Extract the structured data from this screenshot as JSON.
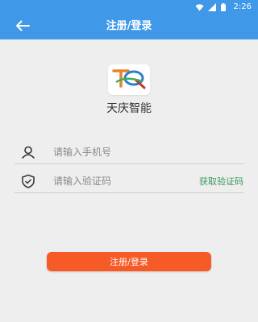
{
  "status_bar": {
    "time": "2:26",
    "icons": [
      "wifi-icon",
      "signal-icon",
      "battery-icon"
    ]
  },
  "toolbar": {
    "title": "注册/登录",
    "back_icon": "back-arrow-icon",
    "color": "#3f98e8"
  },
  "app": {
    "logo_icon": "tq-logo-icon",
    "name": "天庆智能"
  },
  "form": {
    "phone": {
      "icon": "user-icon",
      "placeholder": "请输入手机号",
      "value": ""
    },
    "code": {
      "icon": "shield-icon",
      "placeholder": "请输入验证码",
      "value": "",
      "get_code_label": "获取验证码"
    },
    "submit_label": "注册/登录",
    "submit_color": "#f65a26",
    "link_color": "#3c9a5f"
  }
}
